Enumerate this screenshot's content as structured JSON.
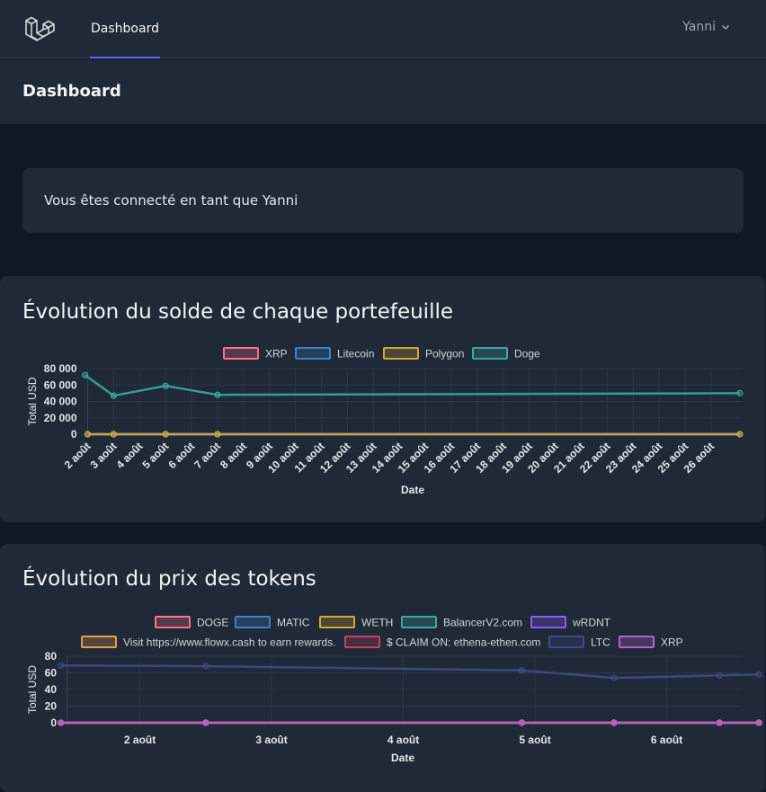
{
  "nav": {
    "active_link": "Dashboard",
    "user_name": "Yanni",
    "accent": "#6366f1"
  },
  "header": {
    "title": "Dashboard"
  },
  "welcome": {
    "message": "Vous êtes connecté en tant que Yanni"
  },
  "chart_data": [
    {
      "type": "line",
      "title": "Évolution du solde de chaque portefeuille",
      "xlabel": "Date",
      "ylabel": "Total USD",
      "ylim": [
        0,
        80000
      ],
      "yticks": [
        "0",
        "20 000",
        "40 000",
        "60 000",
        "80 000"
      ],
      "categories": [
        "2 août",
        "3 août",
        "4 août",
        "5 août",
        "6 août",
        "7 août",
        "8 août",
        "9 août",
        "10 août",
        "11 août",
        "12 août",
        "13 août",
        "14 août",
        "15 août",
        "16 août",
        "17 août",
        "18 août",
        "19 août",
        "20 août",
        "21 août",
        "22 août",
        "23 août",
        "24 août",
        "25 août",
        "26 août"
      ],
      "grid": true,
      "legend_position": "top",
      "series": [
        {
          "name": "XRP",
          "color": "#f87190",
          "points": [
            [
              0,
              0
            ],
            [
              1,
              0
            ],
            [
              3,
              0
            ],
            [
              5,
              0
            ],
            [
              25.1,
              0
            ]
          ]
        },
        {
          "name": "Litecoin",
          "color": "#3b82c6",
          "points": [
            [
              0,
              0
            ],
            [
              1,
              0
            ],
            [
              3,
              0
            ],
            [
              5,
              0
            ],
            [
              25.1,
              0
            ]
          ]
        },
        {
          "name": "Polygon",
          "color": "#d4a73c",
          "points": [
            [
              0,
              0
            ],
            [
              1,
              0
            ],
            [
              3,
              0
            ],
            [
              5,
              0
            ],
            [
              25.1,
              0
            ]
          ]
        },
        {
          "name": "Doge",
          "color": "#3aa8a1",
          "points": [
            [
              -0.1,
              72000
            ],
            [
              1,
              47000
            ],
            [
              3,
              59000
            ],
            [
              5,
              48000
            ],
            [
              25.1,
              50000
            ]
          ]
        }
      ]
    },
    {
      "type": "line",
      "title": "Évolution du prix des tokens",
      "xlabel": "Date",
      "ylabel": "Total USD",
      "ylim": [
        0,
        80
      ],
      "yticks": [
        "0",
        "20",
        "40",
        "60",
        "80"
      ],
      "categories": [
        "2 août",
        "3 août",
        "4 août",
        "5 août",
        "6 août"
      ],
      "grid": true,
      "legend_position": "top",
      "series": [
        {
          "name": "DOGE",
          "color": "#f87190",
          "points": [
            [
              -0.6,
              0
            ],
            [
              0.5,
              0
            ],
            [
              2.9,
              0
            ],
            [
              3.6,
              0
            ],
            [
              4.4,
              0
            ],
            [
              4.7,
              0
            ]
          ]
        },
        {
          "name": "MATIC",
          "color": "#3b82c6",
          "points": [
            [
              -0.6,
              0
            ],
            [
              0.5,
              0
            ],
            [
              2.9,
              0
            ],
            [
              3.6,
              0
            ],
            [
              4.4,
              0
            ],
            [
              4.7,
              0
            ]
          ]
        },
        {
          "name": "WETH",
          "color": "#d4a73c",
          "points": [
            [
              -0.6,
              0
            ],
            [
              0.5,
              0
            ],
            [
              2.9,
              0
            ],
            [
              3.6,
              0
            ],
            [
              4.4,
              0
            ],
            [
              4.7,
              0
            ]
          ]
        },
        {
          "name": "BalancerV2.com",
          "color": "#3aa8a1",
          "points": [
            [
              -0.6,
              0
            ],
            [
              0.5,
              0
            ],
            [
              2.9,
              0
            ],
            [
              3.6,
              0
            ],
            [
              4.4,
              0
            ],
            [
              4.7,
              0
            ]
          ]
        },
        {
          "name": "wRDNT",
          "color": "#8b5cf6",
          "points": [
            [
              -0.6,
              0
            ],
            [
              0.5,
              0
            ],
            [
              2.9,
              0
            ],
            [
              3.6,
              0
            ],
            [
              4.4,
              0
            ],
            [
              4.7,
              0
            ]
          ]
        },
        {
          "name": "Visit https://www.flowx.cash to earn rewards.",
          "color": "#e89b50",
          "points": [
            [
              -0.6,
              0
            ],
            [
              0.5,
              0
            ],
            [
              2.9,
              0
            ],
            [
              3.6,
              0
            ],
            [
              4.4,
              0
            ],
            [
              4.7,
              0
            ]
          ]
        },
        {
          "name": "$ CLAIM ON: ethena-ethen.com",
          "color": "#c94064",
          "points": [
            [
              -0.6,
              0
            ],
            [
              0.5,
              0
            ],
            [
              2.9,
              0
            ],
            [
              3.6,
              0
            ],
            [
              4.4,
              0
            ],
            [
              4.7,
              0
            ]
          ]
        },
        {
          "name": "LTC",
          "color": "#3f4a86",
          "points": [
            [
              -0.6,
              69
            ],
            [
              0.5,
              68
            ],
            [
              2.9,
              63
            ],
            [
              3.6,
              54
            ],
            [
              4.4,
              57
            ],
            [
              4.7,
              58
            ]
          ]
        },
        {
          "name": "XRP",
          "color": "#b563c9",
          "points": [
            [
              -0.6,
              0
            ],
            [
              0.5,
              0
            ],
            [
              2.9,
              0
            ],
            [
              3.6,
              0
            ],
            [
              4.4,
              0
            ],
            [
              4.7,
              0
            ]
          ]
        }
      ]
    }
  ]
}
